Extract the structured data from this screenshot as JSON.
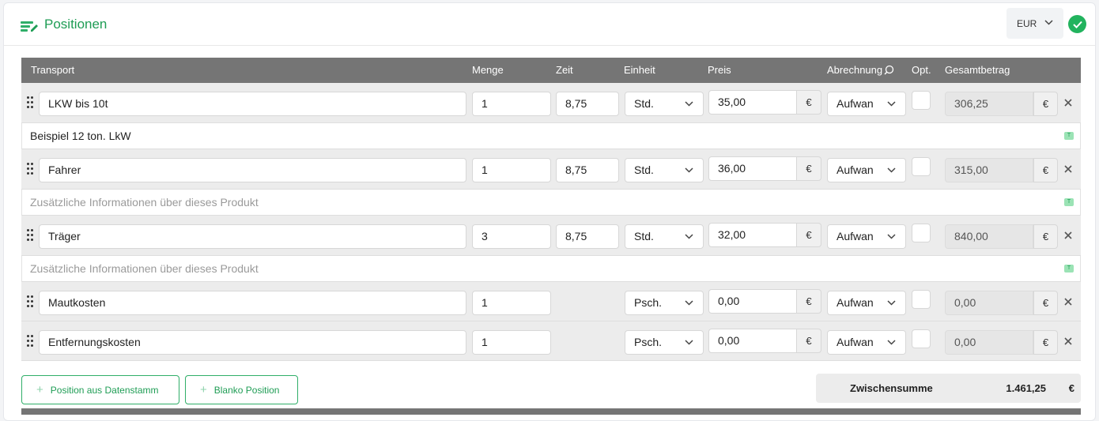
{
  "header": {
    "title": "Positionen",
    "currency": "EUR",
    "status_icon": "check-icon",
    "accent_color": "#1f9d55"
  },
  "columns": {
    "transport": "Transport",
    "menge": "Menge",
    "zeit": "Zeit",
    "einheit": "Einheit",
    "preis": "Preis",
    "abrechnung": "Abrechnung",
    "opt": "Opt.",
    "gesamtbetrag": "Gesamtbetrag"
  },
  "rows": [
    {
      "name": "LKW bis 10t",
      "menge": "1",
      "zeit": "8,75",
      "einheit": "Std.",
      "preis": "35,00",
      "currency_symbol": "€",
      "abrechnung": "Aufwan",
      "optional": false,
      "gesamt": "306,25",
      "description": "Beispiel 12 ton. LkW"
    },
    {
      "name": "Fahrer",
      "menge": "1",
      "zeit": "8,75",
      "einheit": "Std.",
      "preis": "36,00",
      "currency_symbol": "€",
      "abrechnung": "Aufwan",
      "optional": false,
      "gesamt": "315,00",
      "description_placeholder": "Zusätzliche Informationen über dieses Produkt"
    },
    {
      "name": "Träger",
      "menge": "3",
      "zeit": "8,75",
      "einheit": "Std.",
      "preis": "32,00",
      "currency_symbol": "€",
      "abrechnung": "Aufwan",
      "optional": false,
      "gesamt": "840,00",
      "description_placeholder": "Zusätzliche Informationen über dieses Produkt"
    },
    {
      "name": "Mautkosten",
      "menge": "1",
      "zeit": "",
      "einheit": "Psch.",
      "preis": "0,00",
      "currency_symbol": "€",
      "abrechnung": "Aufwan",
      "optional": false,
      "gesamt": "0,00"
    },
    {
      "name": "Entfernungskosten",
      "menge": "1",
      "zeit": "",
      "einheit": "Psch.",
      "preis": "0,00",
      "currency_symbol": "€",
      "abrechnung": "Aufwan",
      "optional": false,
      "gesamt": "0,00"
    }
  ],
  "description_badge": "T",
  "footer": {
    "add_from_master": "Position aus Datenstamm",
    "add_blank": "Blanko Position",
    "subtotal_label": "Zwischensumme",
    "subtotal_value": "1.461,25",
    "subtotal_currency": "€"
  }
}
